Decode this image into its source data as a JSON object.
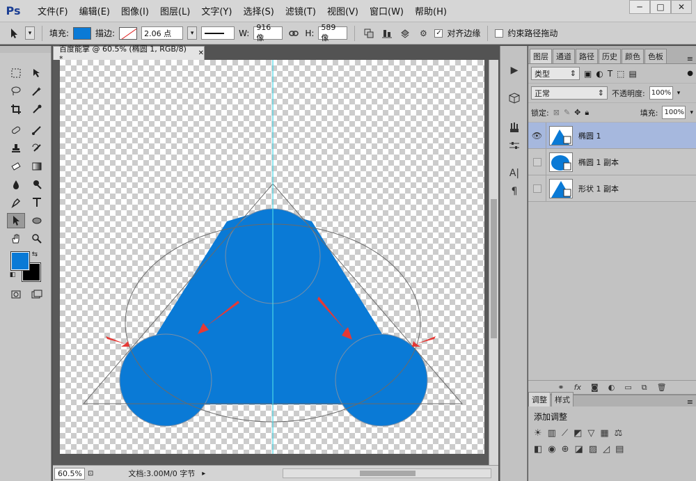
{
  "menubar": {
    "logo": "Ps",
    "items": [
      "文件(F)",
      "编辑(E)",
      "图像(I)",
      "图层(L)",
      "文字(Y)",
      "选择(S)",
      "滤镜(T)",
      "视图(V)",
      "窗口(W)",
      "帮助(H)"
    ],
    "window_buttons": [
      "─",
      "□",
      "✕"
    ]
  },
  "options": {
    "fill_label": "填充:",
    "stroke_label": "描边:",
    "stroke_width": "2.06 点",
    "w_label": "W:",
    "w_value": "916 像",
    "h_label": "H:",
    "h_value": "589 像",
    "align_edges_label": "对齐边缘",
    "constrain_path_label": "约束路径拖动",
    "fill_color": "#0a7ad6"
  },
  "document": {
    "tab_title": "百度能掌 @ 60.5% (椭圆 1, RGB/8) *",
    "zoom": "60.5%",
    "status": "文档:3.00M/0 字节"
  },
  "layers_panel": {
    "tabs": [
      "图层",
      "通道",
      "路径",
      "历史",
      "颜色",
      "色板"
    ],
    "filter_select": "类型",
    "blend_mode": "正常",
    "opacity_label": "不透明度:",
    "opacity_value": "100%",
    "lock_label": "锁定:",
    "fill_label": "填充:",
    "fill_value": "100%",
    "layers": [
      {
        "name": "椭圆 1",
        "visible": true,
        "selected": true
      },
      {
        "name": "椭圆 1 副本",
        "visible": false,
        "selected": false
      },
      {
        "name": "形状 1 副本",
        "visible": false,
        "selected": false
      }
    ],
    "footer_fx": "fx"
  },
  "adjustments_panel": {
    "tabs": [
      "调整",
      "样式"
    ],
    "title": "添加调整"
  },
  "colors": {
    "shape_blue": "#0a7ad6",
    "guide_cyan": "#49d6e6",
    "arrow_red": "#e53935"
  }
}
